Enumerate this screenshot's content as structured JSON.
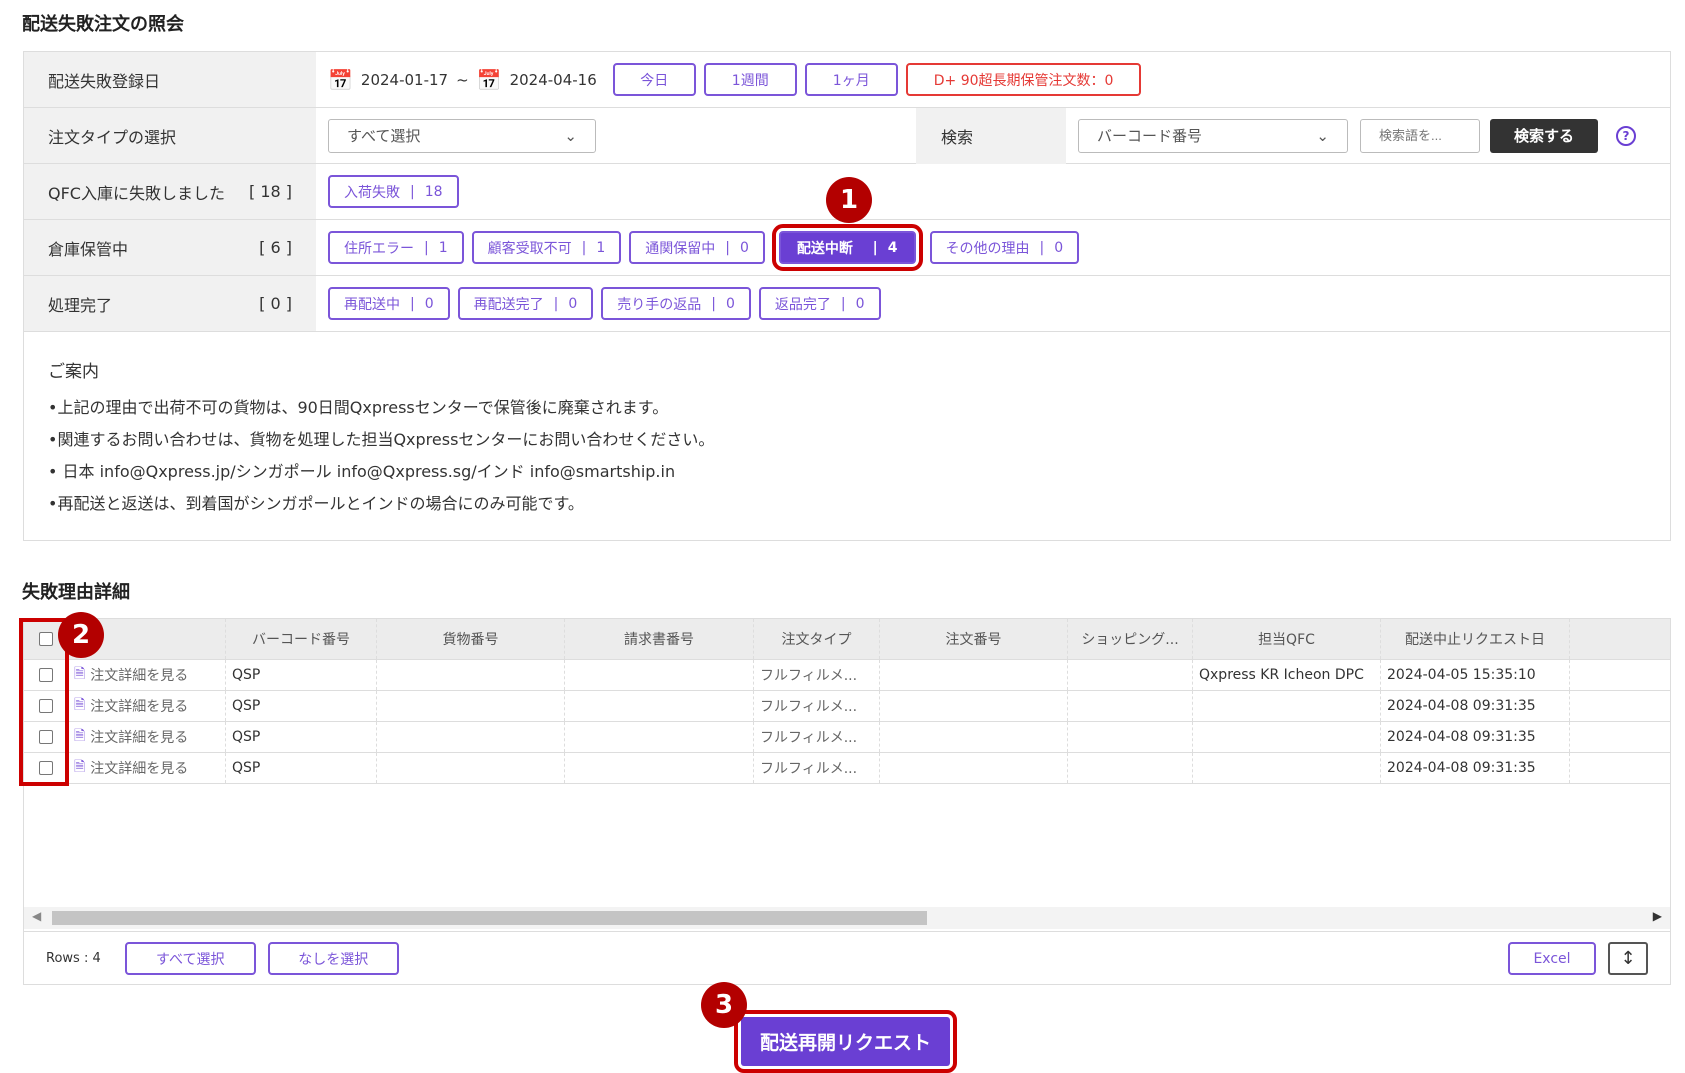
{
  "title": "配送失敗注文の照会",
  "filters": {
    "date_label": "配送失敗登録日",
    "date_from": "2024-01-17",
    "tilde": "~",
    "date_to": "2024-04-16",
    "today": "今日",
    "week": "1週間",
    "month": "1ヶ月",
    "long_term": "D+ 90超長期保管注文数：0",
    "order_type_label": "注文タイプの選択",
    "order_type_value": "すべて選択",
    "search_label": "検索",
    "search_field": "バーコード番号",
    "search_placeholder": "検索語を...",
    "search_button": "検索する",
    "qfc_label": "QFC入庫に失敗しました",
    "qfc_count": "[ 18 ]",
    "qfc_buttons": [
      {
        "label": "入荷失敗",
        "count": "18"
      }
    ],
    "warehouse_label": "倉庫保管中",
    "warehouse_count": "[ 6 ]",
    "warehouse_buttons": [
      {
        "label": "住所エラー",
        "count": "1"
      },
      {
        "label": "顧客受取不可",
        "count": "1"
      },
      {
        "label": "通関保留中",
        "count": "0"
      },
      {
        "label": "配送中断",
        "count": "4"
      },
      {
        "label": "その他の理由",
        "count": "0"
      }
    ],
    "done_label": "処理完了",
    "done_count": "[ 0 ]",
    "done_buttons": [
      {
        "label": "再配送中",
        "count": "0"
      },
      {
        "label": "再配送完了",
        "count": "0"
      },
      {
        "label": "売り手の返品",
        "count": "0"
      },
      {
        "label": "返品完了",
        "count": "0"
      }
    ]
  },
  "guide": {
    "title": "ご案内",
    "lines": [
      "•上記の理由で出荷不可の貨物は、90日間Qxpressセンターで保管後に廃棄されます。",
      "•関連するお問い合わせは、貨物を処理した担当Qxpressセンターにお問い合わせください。",
      "• 日本 info@Qxpress.jp/シンガポール info@Qxpress.sg/インド info@smartship.in",
      "•再配送と返送は、到着国がシンガポールとインドの場合にのみ可能です。"
    ]
  },
  "details_title": "失敗理由詳細",
  "table": {
    "columns": [
      "",
      "",
      "バーコード番号",
      "貨物番号",
      "請求書番号",
      "注文タイプ",
      "注文番号",
      "ショッピング...",
      "担当QFC",
      "配送中止リクエスト日"
    ],
    "rows": [
      {
        "link": "注文詳細を見る",
        "barcode": "QSP",
        "type": "フルフィルメ...",
        "qfc": "Qxpress KR Icheon DPC",
        "date": "2024-04-05 15:35:10"
      },
      {
        "link": "注文詳細を見る",
        "barcode": "QSP",
        "type": "フルフィルメ...",
        "qfc": "",
        "date": "2024-04-08 09:31:35"
      },
      {
        "link": "注文詳細を見る",
        "barcode": "QSP",
        "type": "フルフィルメ...",
        "qfc": "",
        "date": "2024-04-08 09:31:35"
      },
      {
        "link": "注文詳細を見る",
        "barcode": "QSP",
        "type": "フルフィルメ...",
        "qfc": "",
        "date": "2024-04-08 09:31:35"
      }
    ],
    "rows_count": "Rows : 4",
    "select_all": "すべて選択",
    "select_none": "なしを選択",
    "excel": "Excel"
  },
  "resume_button": "配送再開リクエスト",
  "badges": [
    "1",
    "2",
    "3"
  ]
}
